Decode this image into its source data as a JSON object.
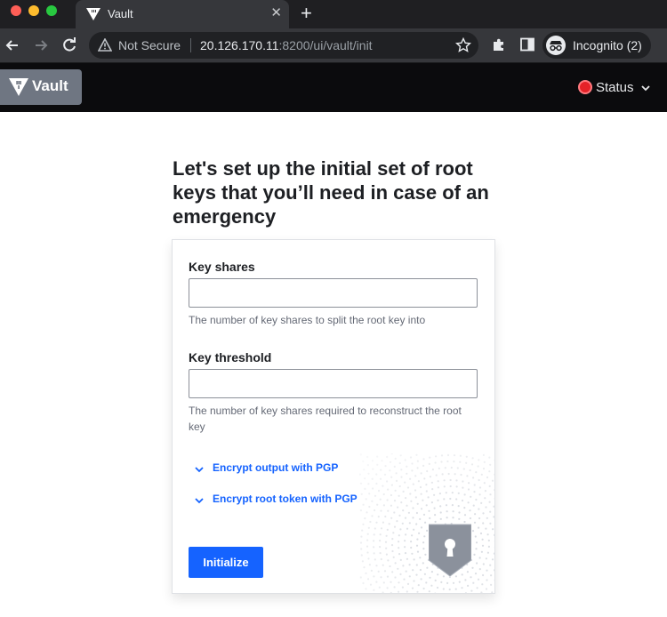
{
  "browser": {
    "tab_title": "Vault",
    "tab_close_glyph": "✕",
    "new_tab_glyph": "+",
    "security_label": "Not Secure",
    "url_host": "20.126.170.11",
    "url_rest": ":8200/ui/vault/init",
    "incognito_label": "Incognito (2)"
  },
  "header": {
    "logo_text": "Vault",
    "status_label": "Status",
    "status_color": "#e52228"
  },
  "page": {
    "title": "Let's set up the initial set of root keys that you’ll need in case of an emergency"
  },
  "form": {
    "key_shares_label": "Key shares",
    "key_shares_value": "",
    "key_shares_help": "The number of key shares to split the root key into",
    "key_threshold_label": "Key threshold",
    "key_threshold_value": "",
    "key_threshold_help": "The number of key shares required to reconstruct the root key",
    "encrypt_output_label": "Encrypt output with PGP",
    "encrypt_root_token_label": "Encrypt root token with PGP",
    "submit_label": "Initialize",
    "accent_color": "#1563ff"
  }
}
